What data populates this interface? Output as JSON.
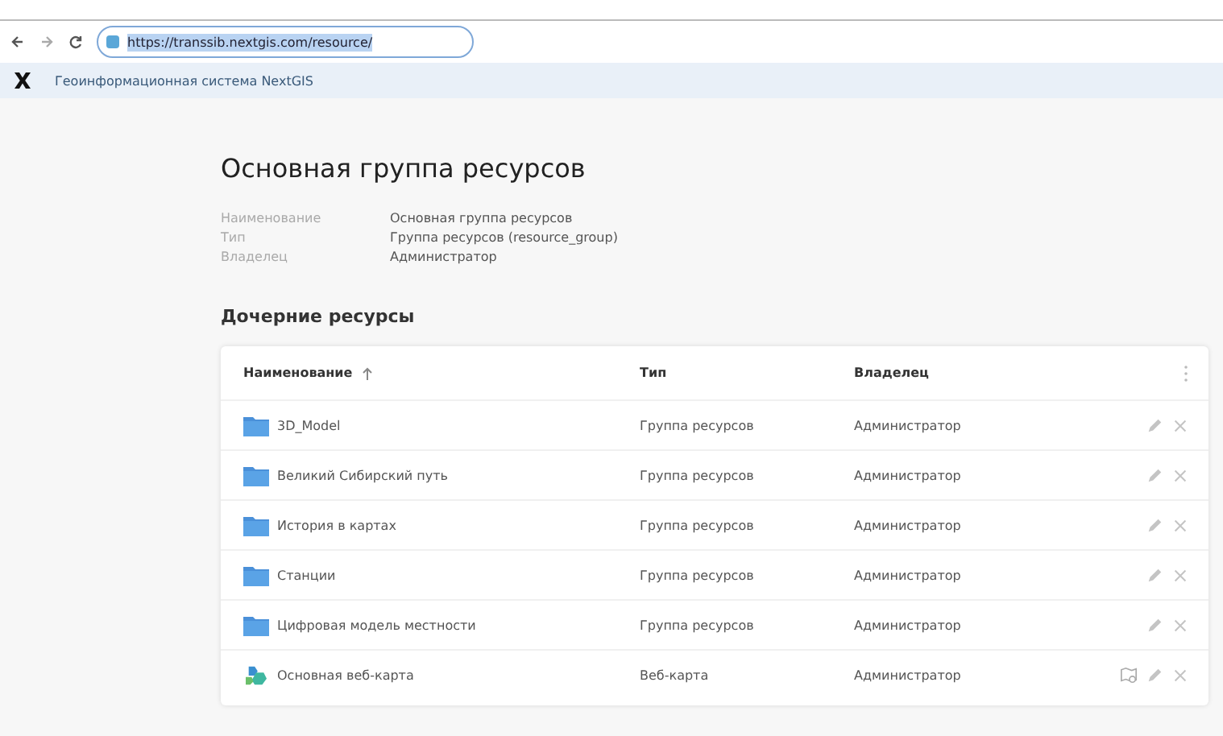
{
  "browser": {
    "url": "https://transsib.nextgis.com/resource/",
    "url_selected": true
  },
  "header": {
    "title": "Геоинформационная система NextGIS"
  },
  "page": {
    "title": "Основная группа ресурсов",
    "properties": [
      {
        "label": "Наименование",
        "value": "Основная группа ресурсов"
      },
      {
        "label": "Тип",
        "value": "Группа ресурсов (resource_group)"
      },
      {
        "label": "Владелец",
        "value": "Администратор"
      }
    ]
  },
  "children": {
    "title": "Дочерние ресурсы",
    "columns": [
      {
        "label": "Наименование",
        "sorted_ascending": true
      },
      {
        "label": "Тип"
      },
      {
        "label": "Владелец"
      }
    ],
    "rows": [
      {
        "kind": "folder",
        "name": "3D_Model",
        "type": "Группа ресурсов",
        "owner": "Администратор"
      },
      {
        "kind": "folder",
        "name": "Великий Сибирский путь",
        "type": "Группа ресурсов",
        "owner": "Администратор"
      },
      {
        "kind": "folder",
        "name": "История в картах",
        "type": "Группа ресурсов",
        "owner": "Администратор"
      },
      {
        "kind": "folder",
        "name": "Станции",
        "type": "Группа ресурсов",
        "owner": "Администратор"
      },
      {
        "kind": "folder",
        "name": "Цифровая модель местности",
        "type": "Группа ресурсов",
        "owner": "Администратор"
      },
      {
        "kind": "webmap",
        "name": "Основная веб-карта",
        "type": "Веб-карта",
        "owner": "Администратор"
      }
    ]
  }
}
